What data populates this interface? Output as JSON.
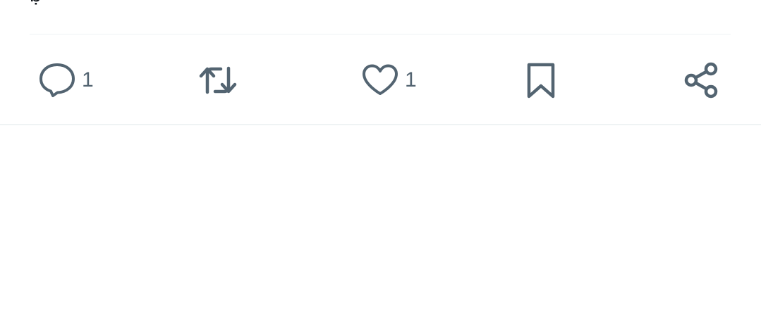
{
  "post": {
    "clipped_text": "ḅ"
  },
  "actions": {
    "reply": {
      "icon": "reply-icon",
      "count": "1"
    },
    "retweet": {
      "icon": "retweet-icon",
      "count": ""
    },
    "like": {
      "icon": "heart-icon",
      "count": "1"
    },
    "bookmark": {
      "icon": "bookmark-icon"
    },
    "share": {
      "icon": "share-icon"
    }
  },
  "colors": {
    "icon": "#536471",
    "divider": "#eff3f4",
    "background": "#ffffff"
  }
}
